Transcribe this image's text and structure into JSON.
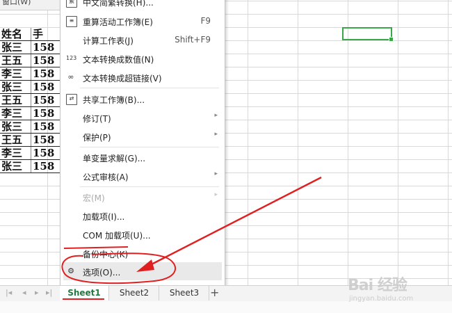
{
  "toolbar": {
    "partial_label": "窗口(W)"
  },
  "sheet": {
    "headers": [
      "姓名",
      "手"
    ],
    "rows": [
      [
        "张三",
        "158"
      ],
      [
        "王五",
        "158"
      ],
      [
        "李三",
        "158"
      ],
      [
        "张三",
        "158"
      ],
      [
        "王五",
        "158"
      ],
      [
        "李三",
        "158"
      ],
      [
        "张三",
        "158"
      ],
      [
        "王五",
        "158"
      ],
      [
        "李三",
        "158"
      ],
      [
        "张三",
        "158"
      ]
    ]
  },
  "menu": {
    "items": [
      {
        "label": "中文简繁转换(H)...",
        "icon": "convert-icon"
      },
      {
        "label": "重算活动工作簿(E)",
        "shortcut": "F9",
        "icon": "recalc-icon"
      },
      {
        "label": "计算工作表(J)",
        "shortcut": "Shift+F9"
      },
      {
        "label": "文本转换成数值(N)",
        "icon": "number-icon"
      },
      {
        "label": "文本转换成超链接(V)",
        "icon": "link-icon"
      },
      {
        "label": "共享工作簿(B)...",
        "icon": "share-icon"
      },
      {
        "label": "修订(T)",
        "submenu": true
      },
      {
        "label": "保护(P)",
        "submenu": true
      },
      {
        "label": "单变量求解(G)..."
      },
      {
        "label": "公式审核(A)",
        "submenu": true
      },
      {
        "label": "宏(M)",
        "submenu": true,
        "disabled": true
      },
      {
        "label": "加载项(I)..."
      },
      {
        "label": "COM 加载项(U)..."
      },
      {
        "label": "备份中心(K)"
      },
      {
        "label": "选项(O)...",
        "icon": "gear-icon",
        "highlighted": true
      }
    ]
  },
  "tabs": {
    "items": [
      "Sheet1",
      "Sheet2",
      "Sheet3"
    ],
    "active": "Sheet1",
    "add_label": "+"
  },
  "watermark": {
    "logo": "Bai 经验",
    "sub": "jingyan.baidu.com"
  },
  "colors": {
    "annotation": "#e02020",
    "selection": "#3aa64a",
    "active_tab_text": "#1e7d3c"
  }
}
